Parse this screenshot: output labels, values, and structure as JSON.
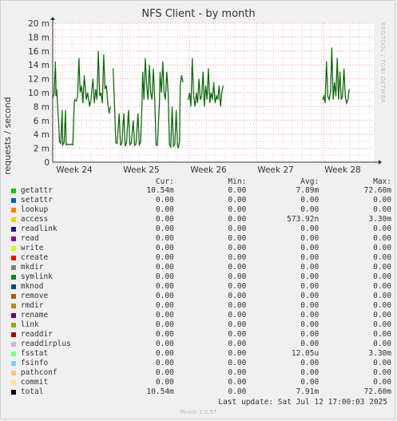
{
  "chart_data": {
    "type": "line",
    "title": "NFS Client - by month",
    "ylabel": "requests / second",
    "ylim": [
      0,
      20
    ],
    "yticks": [
      0,
      2,
      4,
      6,
      8,
      10,
      12,
      14,
      16,
      18,
      20
    ],
    "ytick_labels": [
      "0",
      "2 m",
      "4 m",
      "6 m",
      "8 m",
      "10 m",
      "12 m",
      "14 m",
      "16 m",
      "18 m",
      "20 m"
    ],
    "xticks": [
      "Week 24",
      "Week 25",
      "Week 26",
      "Week 27",
      "Week 28"
    ],
    "grid": true,
    "series_color": "#00cc00",
    "series": [
      {
        "name": "total",
        "segments": [
          [
            [
              0,
              9.2
            ],
            [
              0.02,
              9.8
            ],
            [
              0.04,
              14.5
            ],
            [
              0.05,
              9.5
            ],
            [
              0.06,
              10.5
            ],
            [
              0.08,
              7
            ],
            [
              0.09,
              5.5
            ],
            [
              0.1,
              3
            ],
            [
              0.12,
              2.7
            ],
            [
              0.14,
              7.5
            ],
            [
              0.15,
              2.5
            ],
            [
              0.17,
              2.8
            ],
            [
              0.19,
              7.5
            ],
            [
              0.2,
              2.5
            ],
            [
              0.22,
              2.6
            ],
            [
              0.25,
              2.5
            ],
            [
              0.27,
              2.6
            ],
            [
              0.3,
              2.5
            ],
            [
              0.32,
              8.5
            ],
            [
              0.33,
              9
            ],
            [
              0.35,
              8.8
            ],
            [
              0.37,
              9.5
            ],
            [
              0.39,
              15
            ],
            [
              0.41,
              10
            ],
            [
              0.43,
              11
            ],
            [
              0.45,
              8.5
            ],
            [
              0.47,
              12.5
            ],
            [
              0.5,
              9
            ],
            [
              0.52,
              10
            ],
            [
              0.55,
              8
            ],
            [
              0.57,
              9
            ],
            [
              0.6,
              12
            ],
            [
              0.62,
              8.5
            ],
            [
              0.64,
              10.5
            ],
            [
              0.66,
              9
            ],
            [
              0.68,
              16
            ],
            [
              0.7,
              9.5
            ],
            [
              0.72,
              10
            ],
            [
              0.74,
              8.5
            ],
            [
              0.76,
              15.5
            ],
            [
              0.78,
              10.5
            ],
            [
              0.8,
              11
            ],
            [
              0.82,
              8.5
            ],
            [
              0.84,
              7
            ],
            [
              0.86,
              8
            ]
          ],
          [
            [
              0.9,
              13.5
            ],
            [
              0.92,
              8.5
            ],
            [
              0.94,
              2.8
            ],
            [
              0.96,
              2.7
            ],
            [
              0.99,
              7
            ],
            [
              1.01,
              2.5
            ],
            [
              1.03,
              2.6
            ],
            [
              1.06,
              7
            ],
            [
              1.08,
              2.3
            ],
            [
              1.1,
              2.8
            ],
            [
              1.13,
              7.5
            ],
            [
              1.15,
              2.5
            ],
            [
              1.17,
              2.7
            ],
            [
              1.2,
              6
            ],
            [
              1.22,
              2.4
            ],
            [
              1.24,
              2.6
            ],
            [
              1.27,
              7
            ],
            [
              1.29,
              2.5
            ],
            [
              1.31,
              2.8
            ],
            [
              1.33,
              8
            ],
            [
              1.34,
              13
            ],
            [
              1.36,
              9
            ],
            [
              1.38,
              15
            ],
            [
              1.4,
              11
            ],
            [
              1.42,
              9
            ],
            [
              1.44,
              14
            ],
            [
              1.46,
              10
            ],
            [
              1.48,
              9
            ],
            [
              1.5,
              13.5
            ],
            [
              1.52,
              9
            ],
            [
              1.54,
              2.5
            ],
            [
              1.56,
              2.4
            ],
            [
              1.59,
              8.5
            ],
            [
              1.6,
              13
            ],
            [
              1.62,
              10
            ],
            [
              1.64,
              14.5
            ],
            [
              1.66,
              10
            ],
            [
              1.68,
              9
            ],
            [
              1.7,
              13
            ],
            [
              1.72,
              10
            ],
            [
              1.74,
              2.5
            ],
            [
              1.76,
              2.2
            ],
            [
              1.78,
              8
            ],
            [
              1.8,
              2.3
            ],
            [
              1.82,
              2.6
            ],
            [
              1.84,
              7.5
            ],
            [
              1.86,
              2.4
            ],
            [
              1.87,
              2
            ],
            [
              1.89,
              3
            ],
            [
              1.9,
              11
            ],
            [
              1.92,
              12.5
            ],
            [
              1.94,
              11.5
            ]
          ],
          [
            [
              2.02,
              9
            ],
            [
              2.04,
              10
            ],
            [
              2.06,
              8
            ],
            [
              2.08,
              15
            ],
            [
              2.1,
              9.5
            ],
            [
              2.12,
              8
            ],
            [
              2.14,
              10
            ],
            [
              2.16,
              8.5
            ],
            [
              2.18,
              12
            ],
            [
              2.2,
              9
            ],
            [
              2.22,
              9.5
            ],
            [
              2.24,
              13
            ],
            [
              2.26,
              8
            ],
            [
              2.28,
              11
            ],
            [
              2.3,
              9
            ],
            [
              2.32,
              13.5
            ],
            [
              2.34,
              8.5
            ],
            [
              2.36,
              10
            ],
            [
              2.38,
              9
            ],
            [
              2.4,
              11.5
            ],
            [
              2.42,
              8.5
            ],
            [
              2.44,
              9.5
            ],
            [
              2.46,
              9
            ],
            [
              2.48,
              11
            ],
            [
              2.5,
              8
            ],
            [
              2.52,
              10
            ],
            [
              2.54,
              11
            ]
          ],
          [
            [
              4.02,
              9
            ],
            [
              4.04,
              9.5
            ],
            [
              4.06,
              8.5
            ],
            [
              4.08,
              14.5
            ],
            [
              4.1,
              9.5
            ],
            [
              4.12,
              9
            ],
            [
              4.14,
              10
            ],
            [
              4.16,
              16.5
            ],
            [
              4.18,
              9
            ],
            [
              4.2,
              11.5
            ],
            [
              4.22,
              9.5
            ],
            [
              4.24,
              15
            ],
            [
              4.26,
              9
            ],
            [
              4.28,
              13
            ],
            [
              4.3,
              9
            ],
            [
              4.32,
              9.5
            ],
            [
              4.34,
              13.5
            ],
            [
              4.36,
              9.5
            ],
            [
              4.38,
              8.5
            ],
            [
              4.4,
              9
            ],
            [
              4.42,
              10.5
            ]
          ]
        ]
      }
    ]
  },
  "legend": {
    "headers": {
      "cur": "Cur:",
      "min": "Min:",
      "avg": "Avg:",
      "max": "Max:"
    },
    "rows": [
      {
        "name": "getattr",
        "color": "#00cc00",
        "cur": "10.54m",
        "min": "0.00",
        "avg": "7.89m",
        "max": "72.60m"
      },
      {
        "name": "setattr",
        "color": "#0066b3",
        "cur": "0.00",
        "min": "0.00",
        "avg": "0.00",
        "max": "0.00"
      },
      {
        "name": "lookup",
        "color": "#ff8000",
        "cur": "0.00",
        "min": "0.00",
        "avg": "0.00",
        "max": "0.00"
      },
      {
        "name": "access",
        "color": "#ffcc00",
        "cur": "0.00",
        "min": "0.00",
        "avg": "573.92n",
        "max": "3.30m"
      },
      {
        "name": "readlink",
        "color": "#330099",
        "cur": "0.00",
        "min": "0.00",
        "avg": "0.00",
        "max": "0.00"
      },
      {
        "name": "read",
        "color": "#990099",
        "cur": "0.00",
        "min": "0.00",
        "avg": "0.00",
        "max": "0.00"
      },
      {
        "name": "write",
        "color": "#ccff00",
        "cur": "0.00",
        "min": "0.00",
        "avg": "0.00",
        "max": "0.00"
      },
      {
        "name": "create",
        "color": "#ff0000",
        "cur": "0.00",
        "min": "0.00",
        "avg": "0.00",
        "max": "0.00"
      },
      {
        "name": "mkdir",
        "color": "#808080",
        "cur": "0.00",
        "min": "0.00",
        "avg": "0.00",
        "max": "0.00"
      },
      {
        "name": "symlink",
        "color": "#008f00",
        "cur": "0.00",
        "min": "0.00",
        "avg": "0.00",
        "max": "0.00"
      },
      {
        "name": "mknod",
        "color": "#00487d",
        "cur": "0.00",
        "min": "0.00",
        "avg": "0.00",
        "max": "0.00"
      },
      {
        "name": "remove",
        "color": "#b35a00",
        "cur": "0.00",
        "min": "0.00",
        "avg": "0.00",
        "max": "0.00"
      },
      {
        "name": "rmdir",
        "color": "#b38f00",
        "cur": "0.00",
        "min": "0.00",
        "avg": "0.00",
        "max": "0.00"
      },
      {
        "name": "rename",
        "color": "#6b006b",
        "cur": "0.00",
        "min": "0.00",
        "avg": "0.00",
        "max": "0.00"
      },
      {
        "name": "link",
        "color": "#8fb300",
        "cur": "0.00",
        "min": "0.00",
        "avg": "0.00",
        "max": "0.00"
      },
      {
        "name": "readdir",
        "color": "#b30000",
        "cur": "0.00",
        "min": "0.00",
        "avg": "0.00",
        "max": "0.00"
      },
      {
        "name": "readdirplus",
        "color": "#bebebe",
        "cur": "0.00",
        "min": "0.00",
        "avg": "0.00",
        "max": "0.00"
      },
      {
        "name": "fsstat",
        "color": "#80ff80",
        "cur": "0.00",
        "min": "0.00",
        "avg": "12.05u",
        "max": "3.30m"
      },
      {
        "name": "fsinfo",
        "color": "#80c9ff",
        "cur": "0.00",
        "min": "0.00",
        "avg": "0.00",
        "max": "0.00"
      },
      {
        "name": "pathconf",
        "color": "#ffc080",
        "cur": "0.00",
        "min": "0.00",
        "avg": "0.00",
        "max": "0.00"
      },
      {
        "name": "commit",
        "color": "#ffe680",
        "cur": "0.00",
        "min": "0.00",
        "avg": "0.00",
        "max": "0.00"
      },
      {
        "name": "total",
        "color": "#000000",
        "cur": "10.54m",
        "min": "0.00",
        "avg": "7.91m",
        "max": "72.60m"
      }
    ]
  },
  "last_update": "Last update: Sat Jul 12 17:00:03 2025",
  "watermark": "RRDTOOL / TOBI OETIKER",
  "footer": "Munin 2.0.57"
}
